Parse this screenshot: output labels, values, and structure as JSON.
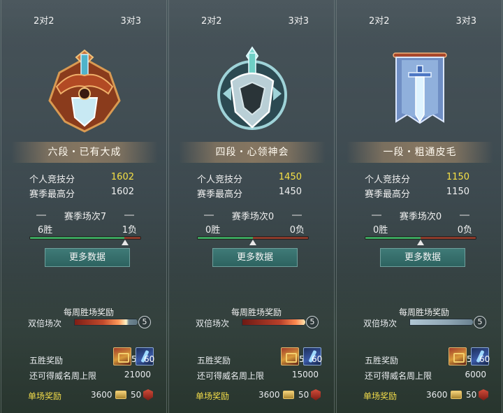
{
  "panels": [
    {
      "tabs": {
        "left": "2对2",
        "right": "3对3"
      },
      "rank_title": "六段・已有大成",
      "emblem": "bronze-winged-shield-emblem",
      "personal_score_label": "个人竞技分",
      "personal_score": "1602",
      "season_high_label": "赛季最高分",
      "season_high": "1602",
      "season_games": "赛季场次7",
      "wins": "6胜",
      "losses": "1负",
      "win_fraction": 0.857,
      "more_button": "更多数据",
      "weekly_title": "每周胜场奖励",
      "double_label": "双倍场次",
      "double_count": "5",
      "five_win_label": "五胜奖励",
      "chest_count": "5",
      "key_count": "60",
      "cap_label": "还可得威名周上限",
      "cap_value": "21000",
      "single_label": "单场奖励",
      "single_gold": "3600",
      "single_token": "50"
    },
    {
      "tabs": {
        "left": "2对2",
        "right": "3对3"
      },
      "rank_title": "四段・心领神会",
      "emblem": "silver-spiked-shield-emblem",
      "personal_score_label": "个人竞技分",
      "personal_score": "1450",
      "season_high_label": "赛季最高分",
      "season_high": "1450",
      "season_games": "赛季场次0",
      "wins": "0胜",
      "losses": "0负",
      "win_fraction": 0.5,
      "more_button": "更多数据",
      "weekly_title": "每周胜场奖励",
      "double_label": "双倍场次",
      "double_count": "5",
      "five_win_label": "五胜奖励",
      "chest_count": "5",
      "key_count": "60",
      "cap_label": "还可得威名周上限",
      "cap_value": "15000",
      "single_label": "单场奖励",
      "single_gold": "3600",
      "single_token": "50"
    },
    {
      "tabs": {
        "left": "2对2",
        "right": "3对3"
      },
      "rank_title": "一段・粗通皮毛",
      "emblem": "blue-banner-sword-emblem",
      "personal_score_label": "个人竞技分",
      "personal_score": "1150",
      "season_high_label": "赛季最高分",
      "season_high": "1150",
      "season_games": "赛季场次0",
      "wins": "0胜",
      "losses": "0负",
      "win_fraction": 0.5,
      "more_button": "更多数据",
      "weekly_title": "每周胜场奖励",
      "double_label": "双倍场次",
      "double_count": "5",
      "five_win_label": "五胜奖励",
      "chest_count": "5",
      "key_count": "60",
      "cap_label": "还可得威名周上限",
      "cap_value": "6000",
      "single_label": "单场奖励",
      "single_gold": "3600",
      "single_token": "50"
    }
  ],
  "colors": {
    "score_gold": "#f6e045",
    "win_green": "#3aa35c",
    "loss_red": "#8b3a2a",
    "button_teal": "#3f7a77",
    "single_reward_yellow": "#f3dd4a"
  }
}
